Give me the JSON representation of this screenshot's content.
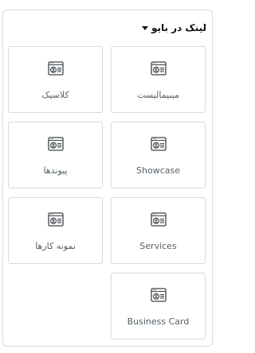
{
  "panel": {
    "title": "لینک در بایو",
    "expanded": true
  },
  "tiles": [
    {
      "label": "مینیمالیست",
      "icon": "profile-card-icon"
    },
    {
      "label": "کلاسیک",
      "icon": "profile-card-icon"
    },
    {
      "label": "Showcase",
      "icon": "profile-card-icon"
    },
    {
      "label": "پیوندها",
      "icon": "profile-card-icon"
    },
    {
      "label": "Services",
      "icon": "profile-card-icon"
    },
    {
      "label": "نمونه کارها",
      "icon": "profile-card-icon"
    },
    {
      "label": "Business Card",
      "icon": "profile-card-icon"
    }
  ],
  "colors": {
    "border": "#d5dadf",
    "label": "#556068",
    "title": "#111111",
    "icon": "#3f4448"
  }
}
